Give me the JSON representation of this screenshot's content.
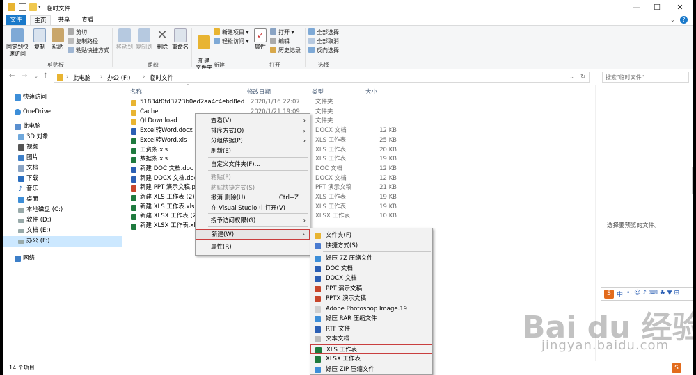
{
  "window": {
    "title": "临时文件"
  },
  "tabs": [
    {
      "label": "文件"
    },
    {
      "label": "主页"
    },
    {
      "label": "共享"
    },
    {
      "label": "查看"
    }
  ],
  "ribbon": {
    "clipboard": {
      "pin": "固定到快速访问",
      "copy": "复制",
      "paste": "粘贴",
      "cut": "剪切",
      "copy_path": "复制路径",
      "paste_shortcut": "粘贴快捷方式",
      "group": "剪贴板"
    },
    "organize": {
      "move_to": "移动到",
      "copy_to": "复制到",
      "delete": "删除",
      "rename": "重命名",
      "group": "组织"
    },
    "new": {
      "new_folder": "新建\n文件夹",
      "new_item": "新建项目 ▾",
      "easy_access": "轻松访问 ▾",
      "group": "新建"
    },
    "open": {
      "properties": "属性",
      "open": "打开 ▾",
      "edit": "编辑",
      "history": "历史记录",
      "group": "打开"
    },
    "select": {
      "select_all": "全部选择",
      "select_none": "全部取消",
      "invert": "反向选择",
      "group": "选择"
    }
  },
  "address": {
    "crumbs": [
      "此电脑",
      "办公 (F:)",
      "临时文件"
    ],
    "sep": "›",
    "search_placeholder": "搜索\"临时文件\""
  },
  "nav": [
    {
      "label": "快速访问"
    },
    {
      "label": "OneDrive"
    },
    {
      "label": "此电脑"
    },
    {
      "label": "3D 对象"
    },
    {
      "label": "视频"
    },
    {
      "label": "图片"
    },
    {
      "label": "文档"
    },
    {
      "label": "下载"
    },
    {
      "label": "音乐"
    },
    {
      "label": "桌面"
    },
    {
      "label": "本地磁盘 (C:)"
    },
    {
      "label": "软件 (D:)"
    },
    {
      "label": "文档 (E:)"
    },
    {
      "label": "办公 (F:)"
    },
    {
      "label": "网络"
    }
  ],
  "columns": {
    "name": "名称",
    "date": "修改日期",
    "type": "类型",
    "size": "大小"
  },
  "files": [
    {
      "name": "51834f0fd3723b0ed2aa4c4ebd8edf13",
      "date": "2020/1/16 22:07",
      "type": "文件夹",
      "size": "",
      "color": "#e8b432"
    },
    {
      "name": "Cache",
      "date": "2020/1/21 19:09",
      "type": "文件夹",
      "size": "",
      "color": "#e8b432"
    },
    {
      "name": "QLDownload",
      "date": "",
      "type": "文件夹",
      "size": "",
      "color": "#e8b432"
    },
    {
      "name": "Excel转Word.docx",
      "date": "",
      "type": "DOCX 文档",
      "size": "12 KB",
      "color": "#2b5fb4"
    },
    {
      "name": "Excel转Word.xls",
      "date": "",
      "type": "XLS 工作表",
      "size": "25 KB",
      "color": "#1f7a3e"
    },
    {
      "name": "工资条.xls",
      "date": "",
      "type": "XLS 工作表",
      "size": "20 KB",
      "color": "#1f7a3e"
    },
    {
      "name": "数据条.xls",
      "date": "",
      "type": "XLS 工作表",
      "size": "19 KB",
      "color": "#1f7a3e"
    },
    {
      "name": "新建 DOC 文档.doc",
      "date": "",
      "type": "DOC 文档",
      "size": "12 KB",
      "color": "#2b5fb4"
    },
    {
      "name": "新建 DOCX 文档.docx",
      "date": "",
      "type": "DOCX 文档",
      "size": "12 KB",
      "color": "#2b5fb4"
    },
    {
      "name": "新建 PPT 演示文稿.ppt",
      "date": "",
      "type": "PPT 演示文稿",
      "size": "21 KB",
      "color": "#c8462b"
    },
    {
      "name": "新建 XLS 工作表 (2).xls",
      "date": "",
      "type": "XLS 工作表",
      "size": "19 KB",
      "color": "#1f7a3e"
    },
    {
      "name": "新建 XLS 工作表.xls",
      "date": "",
      "type": "XLS 工作表",
      "size": "19 KB",
      "color": "#1f7a3e"
    },
    {
      "name": "新建 XLSX 工作表 (2).xlsx",
      "date": "",
      "type": "XLSX 工作表",
      "size": "10 KB",
      "color": "#1f7a3e"
    },
    {
      "name": "新建 XLSX 工作表.xlsx",
      "date": "",
      "type": "",
      "size": "",
      "color": "#1f7a3e"
    }
  ],
  "preview": {
    "text": "选择要预览的文件。"
  },
  "status": {
    "count": "14 个项目"
  },
  "context_menu": [
    {
      "label": "查看(V)",
      "arrow": "›",
      "shortcut": ""
    },
    {
      "label": "排序方式(O)",
      "arrow": "›",
      "shortcut": ""
    },
    {
      "label": "分组依据(P)",
      "arrow": "›",
      "shortcut": ""
    },
    {
      "label": "刷新(E)",
      "arrow": "",
      "shortcut": ""
    },
    {
      "label": "自定义文件夹(F)...",
      "arrow": "",
      "shortcut": ""
    },
    {
      "label": "粘贴(P)",
      "arrow": "",
      "shortcut": ""
    },
    {
      "label": "粘贴快捷方式(S)",
      "arrow": "",
      "shortcut": ""
    },
    {
      "label": "撤消 删除(U)",
      "arrow": "",
      "shortcut": "Ctrl+Z"
    },
    {
      "label": "在 Visual Studio 中打开(V)",
      "arrow": "",
      "shortcut": ""
    },
    {
      "label": "授予访问权限(G)",
      "arrow": "›",
      "shortcut": ""
    },
    {
      "label": "新建(W)",
      "arrow": "›",
      "shortcut": ""
    },
    {
      "label": "属性(R)",
      "arrow": "",
      "shortcut": ""
    }
  ],
  "new_menu": [
    {
      "label": "文件夹(F)",
      "color": "#e8b432"
    },
    {
      "label": "快捷方式(S)",
      "color": "#4a7bd0"
    },
    {
      "label": "好压 7Z 压缩文件",
      "color": "#3d8ed8"
    },
    {
      "label": "DOC 文档",
      "color": "#2b5fb4"
    },
    {
      "label": "DOCX 文档",
      "color": "#2b5fb4"
    },
    {
      "label": "PPT 演示文稿",
      "color": "#c8462b"
    },
    {
      "label": "PPTX 演示文稿",
      "color": "#c8462b"
    },
    {
      "label": "Adobe Photoshop Image.19",
      "color": "#cfcfcf"
    },
    {
      "label": "好压 RAR 压缩文件",
      "color": "#3d8ed8"
    },
    {
      "label": "RTF 文件",
      "color": "#2b5fb4"
    },
    {
      "label": "文本文档",
      "color": "#bbbbbb"
    },
    {
      "label": "XLS 工作表",
      "color": "#1f7a3e"
    },
    {
      "label": "XLSX 工作表",
      "color": "#1f7a3e"
    },
    {
      "label": "好压 ZIP 压缩文件",
      "color": "#3d8ed8"
    }
  ],
  "ime": {
    "logo": "S",
    "lang": "中",
    "items": "•, ☺ ♪ ⌨ ♣ ▼ ⊞"
  },
  "watermark": {
    "brand": "Bai du 经验",
    "url": "jingyan.baidu.com"
  }
}
